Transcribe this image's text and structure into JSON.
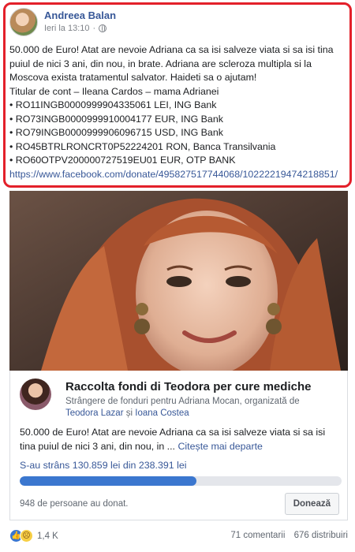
{
  "post": {
    "author": "Andreea Balan",
    "timestamp": "Ieri la 13:10",
    "separator": "·",
    "icons": {
      "avatar": "avatar",
      "privacy": "globe-icon"
    },
    "text_intro": "50.000 de Euro! Atat are nevoie Adriana ca sa isi salveze viata si sa isi tina puiul de nici 3 ani, din nou, in brate. Adriana are scleroza multipla si la Moscova exista tratamentul salvator. Haideti sa o ajutam!",
    "text_holder": "Titular de cont – Ileana Cardos – mama Adrianei",
    "accounts": [
      "RO11INGB0000999904335061 LEI, ING Bank",
      "RO73INGB0000999910004177 EUR, ING Bank",
      "RO79INGB0000999906096715 USD, ING Bank",
      "RO45BTRLRONCRT0P52224201 RON, Banca Transilvania",
      "RO60OTPV200000727519EU01 EUR, OTP BANK"
    ],
    "link": "https://www.facebook.com/donate/495827517744068/10222219474218851/"
  },
  "fundraiser": {
    "title": "Raccolta fondi di Teodora per cure mediche",
    "subtitle_prefix": "Strângere de fonduri pentru Adriana Mocan, organizată de",
    "organizer_1": "Teodora Lazar",
    "and_word": "și",
    "organizer_2": "Ioana Costea",
    "description": "50.000 de Euro! Atat are nevoie Adriana ca sa isi salveze viata si sa isi tina puiul de nici 3 ani, din nou, in ...",
    "see_more": "Citește mai departe",
    "raised_text": "S-au strâns 130.859 lei din 238.391 lei",
    "progress_fraction": 0.549,
    "donors_text": "948 de persoane au donat.",
    "donate_label": "Donează"
  },
  "footer": {
    "reaction_count": "1,4 K",
    "comments": "71 comentarii",
    "shares": "676 distribuiri"
  },
  "colors": {
    "highlight_border": "#e3202a",
    "link_blue": "#385898",
    "progress_blue": "#3b77cf"
  }
}
